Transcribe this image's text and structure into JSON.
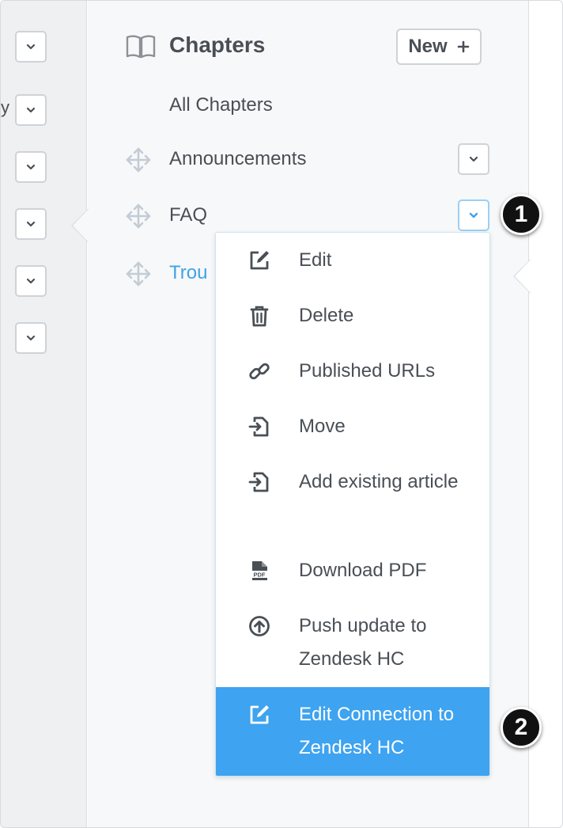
{
  "left_column": {
    "cut_text": "y",
    "dropdown_count": 6
  },
  "panel": {
    "title": "Chapters",
    "new_button_label": "New",
    "new_button_icon": "plus-icon",
    "header_icon": "book-icon"
  },
  "chapters": [
    {
      "label": "All Chapters",
      "draggable": false,
      "has_menu": false,
      "is_link": false
    },
    {
      "label": "Announcements",
      "draggable": true,
      "has_menu": true,
      "is_link": false
    },
    {
      "label": "FAQ",
      "draggable": true,
      "has_menu": true,
      "is_link": false,
      "menu_open": true
    },
    {
      "label": "Trou",
      "draggable": true,
      "has_menu": false,
      "is_link": true
    }
  ],
  "menu": {
    "items": [
      {
        "label": "Edit",
        "icon": "edit-icon"
      },
      {
        "label": "Delete",
        "icon": "trash-icon"
      },
      {
        "label": "Published URLs",
        "icon": "link-icon"
      },
      {
        "label": "Move",
        "icon": "move-in-icon"
      },
      {
        "label": "Add existing article",
        "icon": "add-existing-icon"
      },
      {
        "label": "Download PDF",
        "icon": "pdf-icon"
      },
      {
        "label": "Push update to Zendesk HC",
        "icon": "upload-circle-icon"
      },
      {
        "label": "Edit Connection to Zendesk HC",
        "icon": "edit-icon",
        "highlighted": true
      }
    ]
  },
  "callouts": [
    "1",
    "2"
  ],
  "colors": {
    "accent": "#3ea3f0",
    "link": "#3ea3e6",
    "text": "#4a4f55",
    "sidebar_bg": "#eef0f1",
    "panel_bg": "#f7f8f9"
  }
}
